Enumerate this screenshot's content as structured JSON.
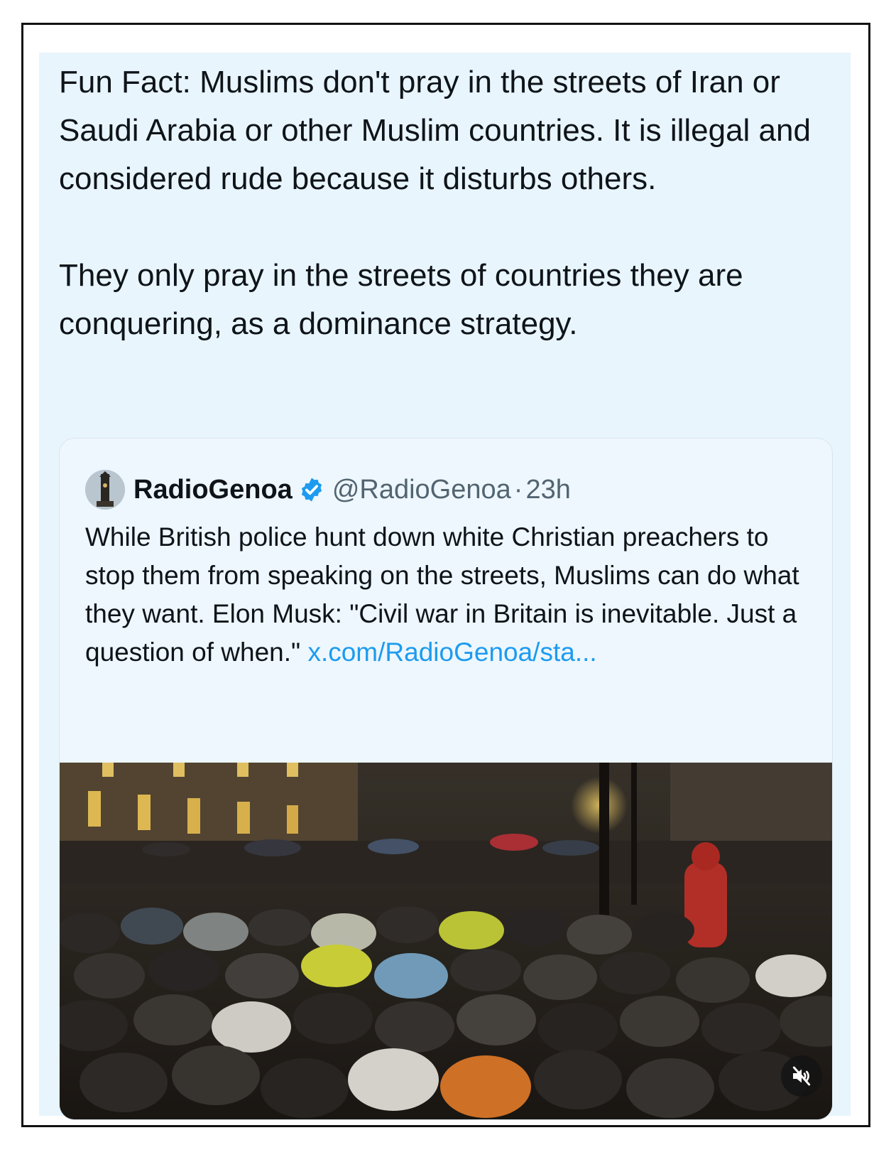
{
  "post": {
    "paragraphs": [
      "Fun Fact: Muslims don't pray in the streets of Iran or Saudi Arabia or other Muslim countries. It is illegal and considered rude because it disturbs others.",
      "They only pray in the streets of countries they are conquering, as a dominance strategy."
    ]
  },
  "quoted_post": {
    "author_name": "RadioGenoa",
    "handle": "@RadioGenoa",
    "separator": "·",
    "time": "23h",
    "body": "While British police hunt down white Christian preachers to stop them from speaking on the streets, Muslims can do what they want. Elon Musk: \"Civil war in Britain is inevitable. Just a question of when.\" ",
    "link_text": "x.com/RadioGenoa/sta...",
    "media": {
      "type": "video",
      "mute_icon": "muted-speaker-icon"
    }
  },
  "colors": {
    "post_background": "#e8f5fd",
    "link": "#1d9bf0",
    "verified": "#1d9bf0",
    "muted_text": "#536471"
  }
}
